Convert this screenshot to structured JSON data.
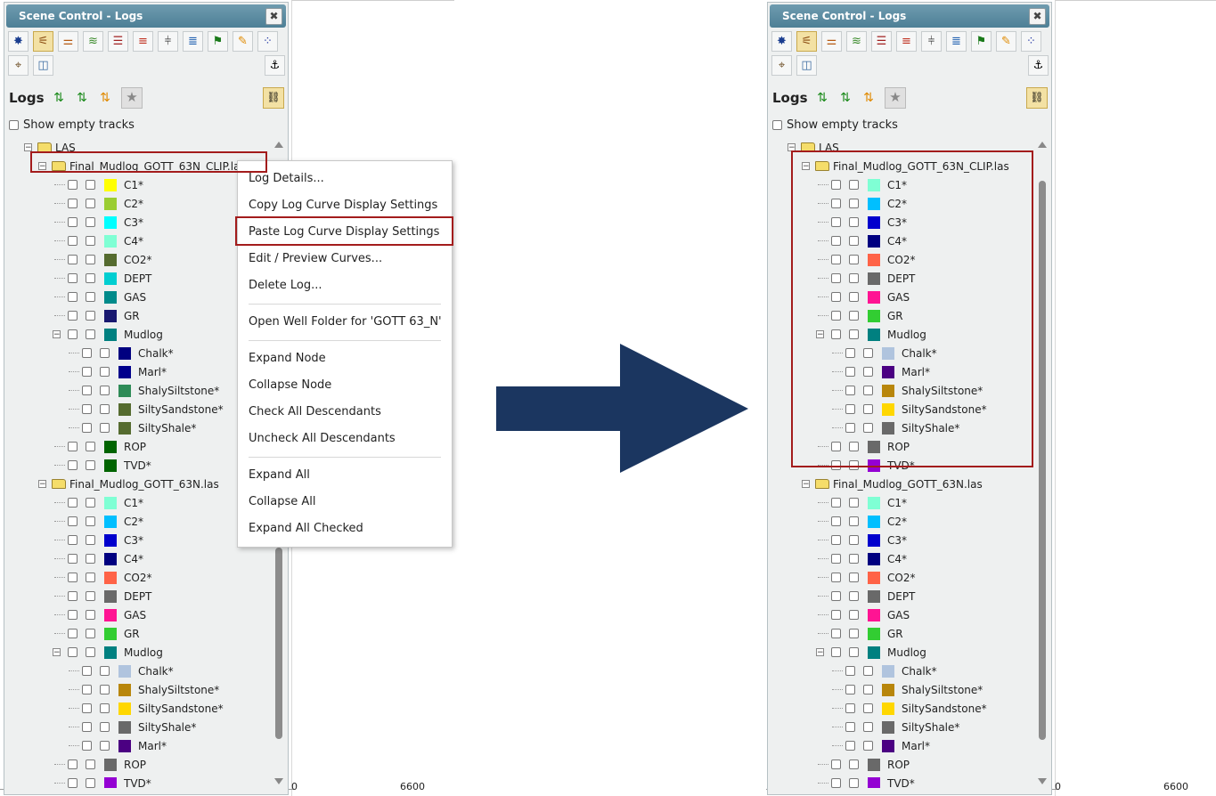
{
  "panel": {
    "title": "Scene Control - Logs",
    "close_label": "✖"
  },
  "logs": {
    "label": "Logs",
    "show_empty_tracks": "Show empty tracks"
  },
  "axis": {
    "label_left": "0",
    "label_right": "6600"
  },
  "context_menu": {
    "items": [
      "Log Details...",
      "Copy Log Curve Display Settings",
      "Paste Log Curve Display Settings",
      "Edit / Preview Curves...",
      "Delete Log...",
      "Open Well Folder for 'GOTT 63_N'",
      "Expand Node",
      "Collapse Node",
      "Check All Descendants",
      "Uncheck All Descendants",
      "Expand All",
      "Collapse All",
      "Expand All Checked"
    ],
    "highlighted": "Paste Log Curve Display Settings"
  },
  "colors": {
    "accent_red": "#a31c1c",
    "arrow": "#1b3660",
    "titlebar": "#5a8aa1"
  },
  "trees": {
    "before": {
      "root": "LAS",
      "log1": {
        "name": "Final_Mudlog_GOTT_63N_CLIP.las",
        "curves": [
          {
            "label": "C1*",
            "color": "#ffff00"
          },
          {
            "label": "C2*",
            "color": "#9acd32"
          },
          {
            "label": "C3*",
            "color": "#00ffff"
          },
          {
            "label": "C4*",
            "color": "#7fffd4"
          },
          {
            "label": "CO2*",
            "color": "#556b2f"
          },
          {
            "label": "DEPT",
            "color": "#00ced1"
          },
          {
            "label": "GAS",
            "color": "#008b8b"
          },
          {
            "label": "GR",
            "color": "#191970"
          }
        ],
        "mudlog": {
          "label": "Mudlog",
          "color": "#008080"
        },
        "mudlog_children": [
          {
            "label": "Chalk*",
            "color": "#000080"
          },
          {
            "label": "Marl*",
            "color": "#00008b"
          },
          {
            "label": "ShalySiltstone*",
            "color": "#2e8b57"
          },
          {
            "label": "SiltySandstone*",
            "color": "#556b2f"
          },
          {
            "label": "SiltyShale*",
            "color": "#556b2f"
          }
        ],
        "tail": [
          {
            "label": "ROP",
            "color": "#006400"
          },
          {
            "label": "TVD*",
            "color": "#006400"
          }
        ]
      },
      "log2": {
        "name": "Final_Mudlog_GOTT_63N.las",
        "curves": [
          {
            "label": "C1*",
            "color": "#7fffd4"
          },
          {
            "label": "C2*",
            "color": "#00bfff"
          },
          {
            "label": "C3*",
            "color": "#0000cd"
          },
          {
            "label": "C4*",
            "color": "#000080"
          },
          {
            "label": "CO2*",
            "color": "#ff6347"
          },
          {
            "label": "DEPT",
            "color": "#696969"
          },
          {
            "label": "GAS",
            "color": "#ff1493"
          },
          {
            "label": "GR",
            "color": "#32cd32"
          }
        ],
        "mudlog": {
          "label": "Mudlog",
          "color": "#008080"
        },
        "mudlog_children": [
          {
            "label": "Chalk*",
            "color": "#b0c4de"
          },
          {
            "label": "ShalySiltstone*",
            "color": "#b8860b"
          },
          {
            "label": "SiltySandstone*",
            "color": "#ffd700"
          },
          {
            "label": "SiltyShale*",
            "color": "#696969"
          },
          {
            "label": "Marl*",
            "color": "#4b0082"
          }
        ],
        "tail": [
          {
            "label": "ROP",
            "color": "#696969"
          },
          {
            "label": "TVD*",
            "color": "#9400d3"
          }
        ]
      }
    },
    "after": {
      "root": "LAS",
      "log1": {
        "name": "Final_Mudlog_GOTT_63N_CLIP.las",
        "curves": [
          {
            "label": "C1*",
            "color": "#7fffd4"
          },
          {
            "label": "C2*",
            "color": "#00bfff"
          },
          {
            "label": "C3*",
            "color": "#0000cd"
          },
          {
            "label": "C4*",
            "color": "#000080"
          },
          {
            "label": "CO2*",
            "color": "#ff6347"
          },
          {
            "label": "DEPT",
            "color": "#696969"
          },
          {
            "label": "GAS",
            "color": "#ff1493"
          },
          {
            "label": "GR",
            "color": "#32cd32"
          }
        ],
        "mudlog": {
          "label": "Mudlog",
          "color": "#008080"
        },
        "mudlog_children": [
          {
            "label": "Chalk*",
            "color": "#b0c4de"
          },
          {
            "label": "Marl*",
            "color": "#4b0082"
          },
          {
            "label": "ShalySiltstone*",
            "color": "#b8860b"
          },
          {
            "label": "SiltySandstone*",
            "color": "#ffd700"
          },
          {
            "label": "SiltyShale*",
            "color": "#696969"
          }
        ],
        "tail": [
          {
            "label": "ROP",
            "color": "#696969"
          },
          {
            "label": "TVD*",
            "color": "#9400d3"
          }
        ]
      },
      "log2": {
        "name": "Final_Mudlog_GOTT_63N.las",
        "curves": [
          {
            "label": "C1*",
            "color": "#7fffd4"
          },
          {
            "label": "C2*",
            "color": "#00bfff"
          },
          {
            "label": "C3*",
            "color": "#0000cd"
          },
          {
            "label": "C4*",
            "color": "#000080"
          },
          {
            "label": "CO2*",
            "color": "#ff6347"
          },
          {
            "label": "DEPT",
            "color": "#696969"
          },
          {
            "label": "GAS",
            "color": "#ff1493"
          },
          {
            "label": "GR",
            "color": "#32cd32"
          }
        ],
        "mudlog": {
          "label": "Mudlog",
          "color": "#008080"
        },
        "mudlog_children": [
          {
            "label": "Chalk*",
            "color": "#b0c4de"
          },
          {
            "label": "ShalySiltstone*",
            "color": "#b8860b"
          },
          {
            "label": "SiltySandstone*",
            "color": "#ffd700"
          },
          {
            "label": "SiltyShale*",
            "color": "#696969"
          },
          {
            "label": "Marl*",
            "color": "#4b0082"
          }
        ],
        "tail": [
          {
            "label": "ROP",
            "color": "#696969"
          },
          {
            "label": "TVD*",
            "color": "#9400d3"
          }
        ]
      }
    }
  }
}
